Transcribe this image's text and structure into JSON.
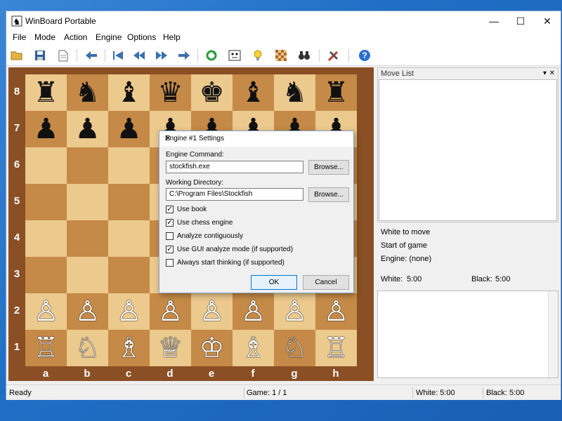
{
  "window": {
    "title": "WinBoard Portable",
    "minimize": "—",
    "maximize": "☐",
    "close": "✕"
  },
  "menu": {
    "items": [
      "File",
      "Mode",
      "Action",
      "Engine",
      "Options",
      "Help"
    ]
  },
  "toolbar": {
    "icons": [
      "folder-open-icon",
      "save-icon",
      "document-icon",
      "back-icon",
      "to-start-icon",
      "rewind-icon",
      "forward-icon",
      "step-forward-icon",
      "refresh-icon",
      "face-icon",
      "hint-bulb-icon",
      "board-icon",
      "binoculars-icon",
      "tools-icon",
      "help-icon"
    ]
  },
  "board": {
    "ranks": [
      "8",
      "7",
      "6",
      "5",
      "4",
      "3",
      "2",
      "1"
    ],
    "files": [
      "a",
      "b",
      "c",
      "d",
      "e",
      "f",
      "g",
      "h"
    ],
    "rows": [
      [
        "♜",
        "♞",
        "♝",
        "♛",
        "♚",
        "♝",
        "♞",
        "♜"
      ],
      [
        "♟",
        "♟",
        "♟",
        "♟",
        "♟",
        "♟",
        "♟",
        "♟"
      ],
      [
        "",
        "",
        "",
        "",
        "",
        "",
        "",
        ""
      ],
      [
        "",
        "",
        "",
        "",
        "",
        "",
        "",
        ""
      ],
      [
        "",
        "",
        "",
        "",
        "",
        "",
        "",
        ""
      ],
      [
        "",
        "",
        "",
        "",
        "",
        "",
        "",
        ""
      ],
      [
        "♙",
        "♙",
        "♙",
        "♙",
        "♙",
        "♙",
        "♙",
        "♙"
      ],
      [
        "♖",
        "♘",
        "♗",
        "♕",
        "♔",
        "♗",
        "♘",
        "♖"
      ]
    ],
    "light_color": "#ecc98d",
    "dark_color": "#c58a47"
  },
  "move_list": {
    "title": "Move List",
    "pin": "▾",
    "close": "✕"
  },
  "info": {
    "to_move": "White to move",
    "status": "Start of game",
    "engine": "Engine: (none)"
  },
  "clocks": {
    "white_label": "White:",
    "white_time": "5:00",
    "black_label": "Black:",
    "black_time": "5:00"
  },
  "statusbar": {
    "ready": "Ready",
    "game": "Game:   1 / 1",
    "white": "White: 5:00",
    "black": "Black: 5:00"
  },
  "dialog": {
    "title": "Engine #1 Settings",
    "close": "✕",
    "engine_command_label": "Engine Command:",
    "engine_command_value": "stockfish.exe",
    "browse1": "Browse...",
    "working_dir_label": "Working Directory:",
    "working_dir_value": "C:\\Program Files\\Stockfish",
    "browse2": "Browse...",
    "options": [
      {
        "label": "Use book",
        "checked": true
      },
      {
        "label": "Use chess engine",
        "checked": true
      },
      {
        "label": "Analyze contiguously",
        "checked": false
      },
      {
        "label": "Use GUI analyze mode (if supported)",
        "checked": true
      },
      {
        "label": "Always start thinking (if supported)",
        "checked": false
      }
    ],
    "ok": "OK",
    "cancel": "Cancel"
  }
}
